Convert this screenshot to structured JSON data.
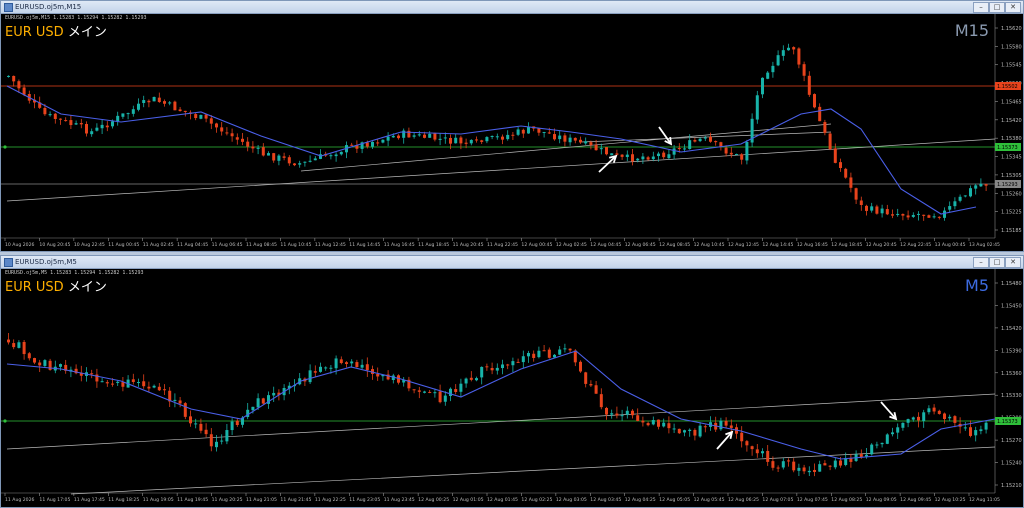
{
  "windows": {
    "top": {
      "title": "EURUSD.oj5m,M15",
      "info": "EURUSD.oj5m,M15  1.15283 1.15294 1.15282 1.15293",
      "main_label": "EUR USD",
      "main_label_jp": "メイン",
      "timeframe": "M15",
      "price_ticks": [
        "1.15620",
        "1.15580",
        "1.15545",
        "1.15500",
        "1.15465",
        "1.15420",
        "1.15380",
        "1.15345",
        "1.15305",
        "1.15260",
        "1.15225",
        "1.15185"
      ],
      "price_tags": {
        "orange": "1.15502",
        "green": "1.15373",
        "white": "1.15293"
      },
      "time_ticks": [
        "10 Aug 2026",
        "10 Aug 20:45",
        "10 Aug 22:45",
        "11 Aug 00:45",
        "11 Aug 02:45",
        "11 Aug 04:45",
        "11 Aug 06:45",
        "11 Aug 08:45",
        "11 Aug 10:45",
        "11 Aug 12:45",
        "11 Aug 14:45",
        "11 Aug 16:45",
        "11 Aug 18:45",
        "11 Aug 20:45",
        "11 Aug 22:45",
        "12 Aug 00:45",
        "12 Aug 02:45",
        "12 Aug 04:45",
        "12 Aug 06:45",
        "12 Aug 08:45",
        "12 Aug 10:45",
        "12 Aug 12:45",
        "12 Aug 14:45",
        "12 Aug 16:45",
        "12 Aug 18:45",
        "12 Aug 20:45",
        "12 Aug 22:45",
        "13 Aug 00:45",
        "13 Aug 02:45"
      ]
    },
    "bottom": {
      "title": "EURUSD.oj5m,M5",
      "info": "EURUSD.oj5m,M5  1.15283 1.15294 1.15282 1.15293",
      "main_label": "EUR USD",
      "main_label_jp": "メイン",
      "timeframe": "M5",
      "price_ticks": [
        "1.15480",
        "1.15450",
        "1.15420",
        "1.15390",
        "1.15360",
        "1.15330",
        "1.15300",
        "1.15270",
        "1.15240",
        "1.15210"
      ],
      "price_tags": {
        "green": "1.15373"
      },
      "time_ticks": [
        "11 Aug 2026",
        "11 Aug 17:05",
        "11 Aug 17:45",
        "11 Aug 18:25",
        "11 Aug 19:05",
        "11 Aug 19:45",
        "11 Aug 20:25",
        "11 Aug 21:05",
        "11 Aug 21:45",
        "11 Aug 22:25",
        "11 Aug 23:05",
        "11 Aug 23:45",
        "12 Aug 00:25",
        "12 Aug 01:05",
        "12 Aug 01:45",
        "12 Aug 02:25",
        "12 Aug 03:05",
        "12 Aug 03:45",
        "12 Aug 04:25",
        "12 Aug 05:05",
        "12 Aug 05:45",
        "12 Aug 06:25",
        "12 Aug 07:05",
        "12 Aug 07:45",
        "12 Aug 08:25",
        "12 Aug 09:05",
        "12 Aug 09:45",
        "12 Aug 10:25",
        "12 Aug 11:05"
      ]
    }
  },
  "colors": {
    "background": "#000000",
    "bull": "#18b3a9",
    "bear": "#e8431c",
    "ma": "#4a5fe8",
    "hline_orange": "#e8431c",
    "hline_green": "#2fbf3a",
    "trendline": "#b8b8b8",
    "arrow": "#ffffff"
  }
}
